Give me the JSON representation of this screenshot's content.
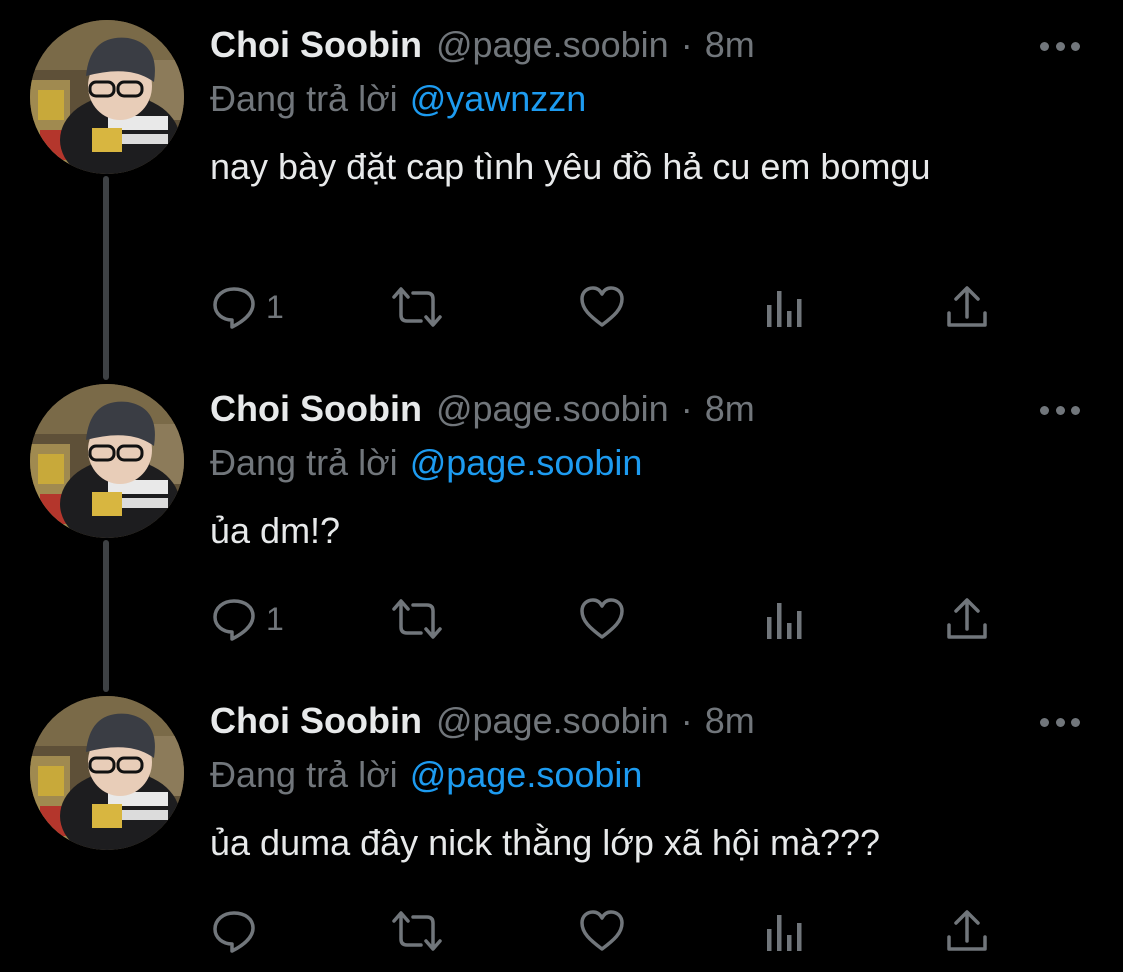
{
  "colors": {
    "background": "#000000",
    "text": "#e7e9ea",
    "muted": "#71767b",
    "link": "#1d9bf0",
    "thread_line": "#3e4144"
  },
  "tweets": [
    {
      "author_name": "Choi Soobin",
      "author_handle": "@page.soobin",
      "separator": "·",
      "time": "8m",
      "reply_prefix": "Đang trả lời",
      "reply_to": "@yawnzzn",
      "text": "nay bày đặt cap tình yêu đồ hả cu em bomgu",
      "reply_count": "1",
      "icons": [
        "more-icon",
        "reply-icon",
        "retweet-icon",
        "like-icon",
        "views-icon",
        "share-icon"
      ]
    },
    {
      "author_name": "Choi Soobin",
      "author_handle": "@page.soobin",
      "separator": "·",
      "time": "8m",
      "reply_prefix": "Đang trả lời",
      "reply_to": "@page.soobin",
      "text": "ủa dm!?",
      "reply_count": "1",
      "icons": [
        "more-icon",
        "reply-icon",
        "retweet-icon",
        "like-icon",
        "views-icon",
        "share-icon"
      ]
    },
    {
      "author_name": "Choi Soobin",
      "author_handle": "@page.soobin",
      "separator": "·",
      "time": "8m",
      "reply_prefix": "Đang trả lời",
      "reply_to": "@page.soobin",
      "text": "ủa duma đây nick thằng lớp xã hội mà???",
      "reply_count": "",
      "icons": [
        "more-icon",
        "reply-icon",
        "retweet-icon",
        "like-icon",
        "views-icon",
        "share-icon"
      ]
    }
  ]
}
